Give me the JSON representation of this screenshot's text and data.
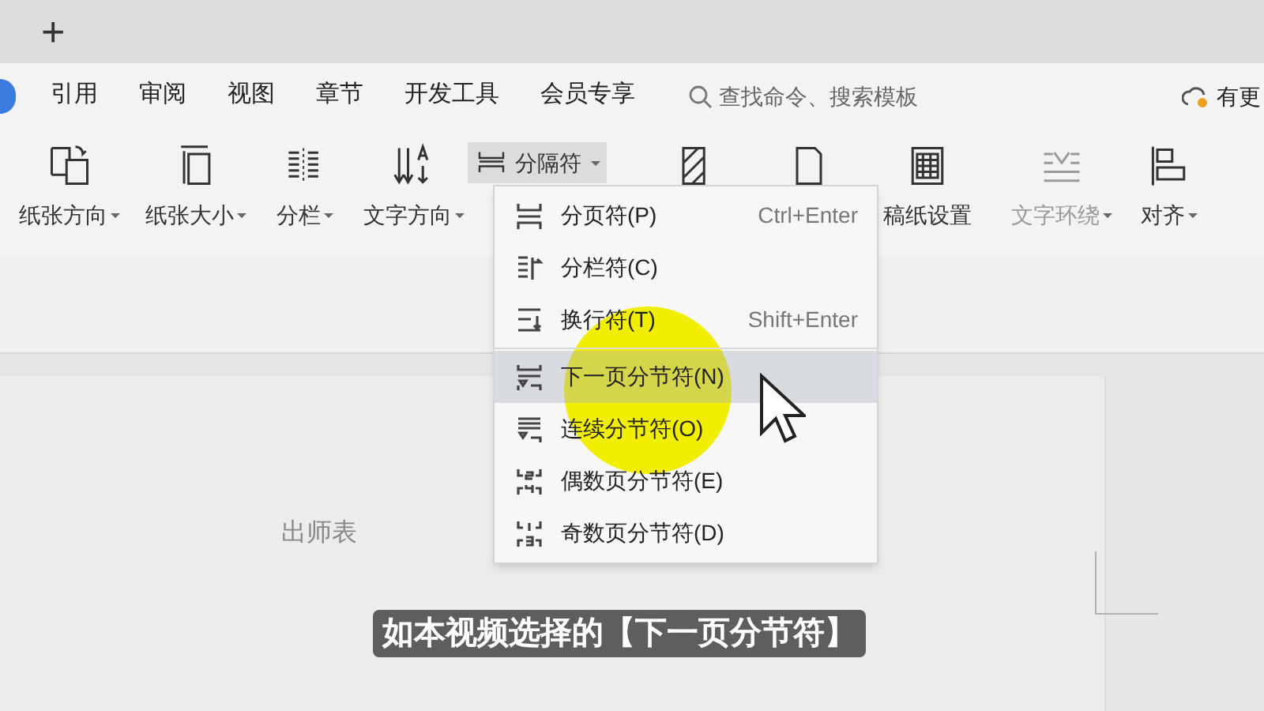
{
  "tab_bar": {
    "new_tab": "+"
  },
  "menu_tabs": [
    {
      "label": "引用",
      "selected": false
    },
    {
      "label": "审阅",
      "selected": false
    },
    {
      "label": "视图",
      "selected": false
    },
    {
      "label": "章节",
      "selected": false
    },
    {
      "label": "开发工具",
      "selected": false
    },
    {
      "label": "会员专享",
      "selected": false
    }
  ],
  "search": {
    "placeholder": "查找命令、搜索模板"
  },
  "cloud_label": "有更",
  "ribbon": [
    {
      "label": "纸张方向",
      "dropdown": true,
      "disabled": false
    },
    {
      "label": "纸张大小",
      "dropdown": true,
      "disabled": false
    },
    {
      "label": "分栏",
      "dropdown": true,
      "disabled": false
    },
    {
      "label": "文字方向",
      "dropdown": true,
      "disabled": false
    },
    {
      "label": "分隔符",
      "dropdown": true,
      "disabled": false,
      "pressed": true
    },
    {
      "dropdown": false,
      "disabled": false
    },
    {
      "dropdown": false,
      "disabled": false
    },
    {
      "label": "稿纸设置",
      "dropdown": false,
      "disabled": false
    },
    {
      "label": "文字环绕",
      "dropdown": true,
      "disabled": true
    },
    {
      "label": "对齐",
      "dropdown": true,
      "disabled": false
    }
  ],
  "break_menu": [
    {
      "label": "分页符(P)",
      "shortcut": "Ctrl+Enter",
      "selected": false
    },
    {
      "label": "分栏符(C)",
      "selected": false
    },
    {
      "label": "换行符(T)",
      "shortcut": "Shift+Enter",
      "selected": false
    },
    {
      "label": "下一页分节符(N)",
      "selected": true
    },
    {
      "label": "连续分节符(O)",
      "selected": false
    },
    {
      "label": "偶数页分节符(E)",
      "selected": false
    },
    {
      "label": "奇数页分节符(D)",
      "selected": false
    }
  ],
  "document": {
    "heading": "出师表"
  },
  "caption": "如本视频选择的【下一页分节符】"
}
